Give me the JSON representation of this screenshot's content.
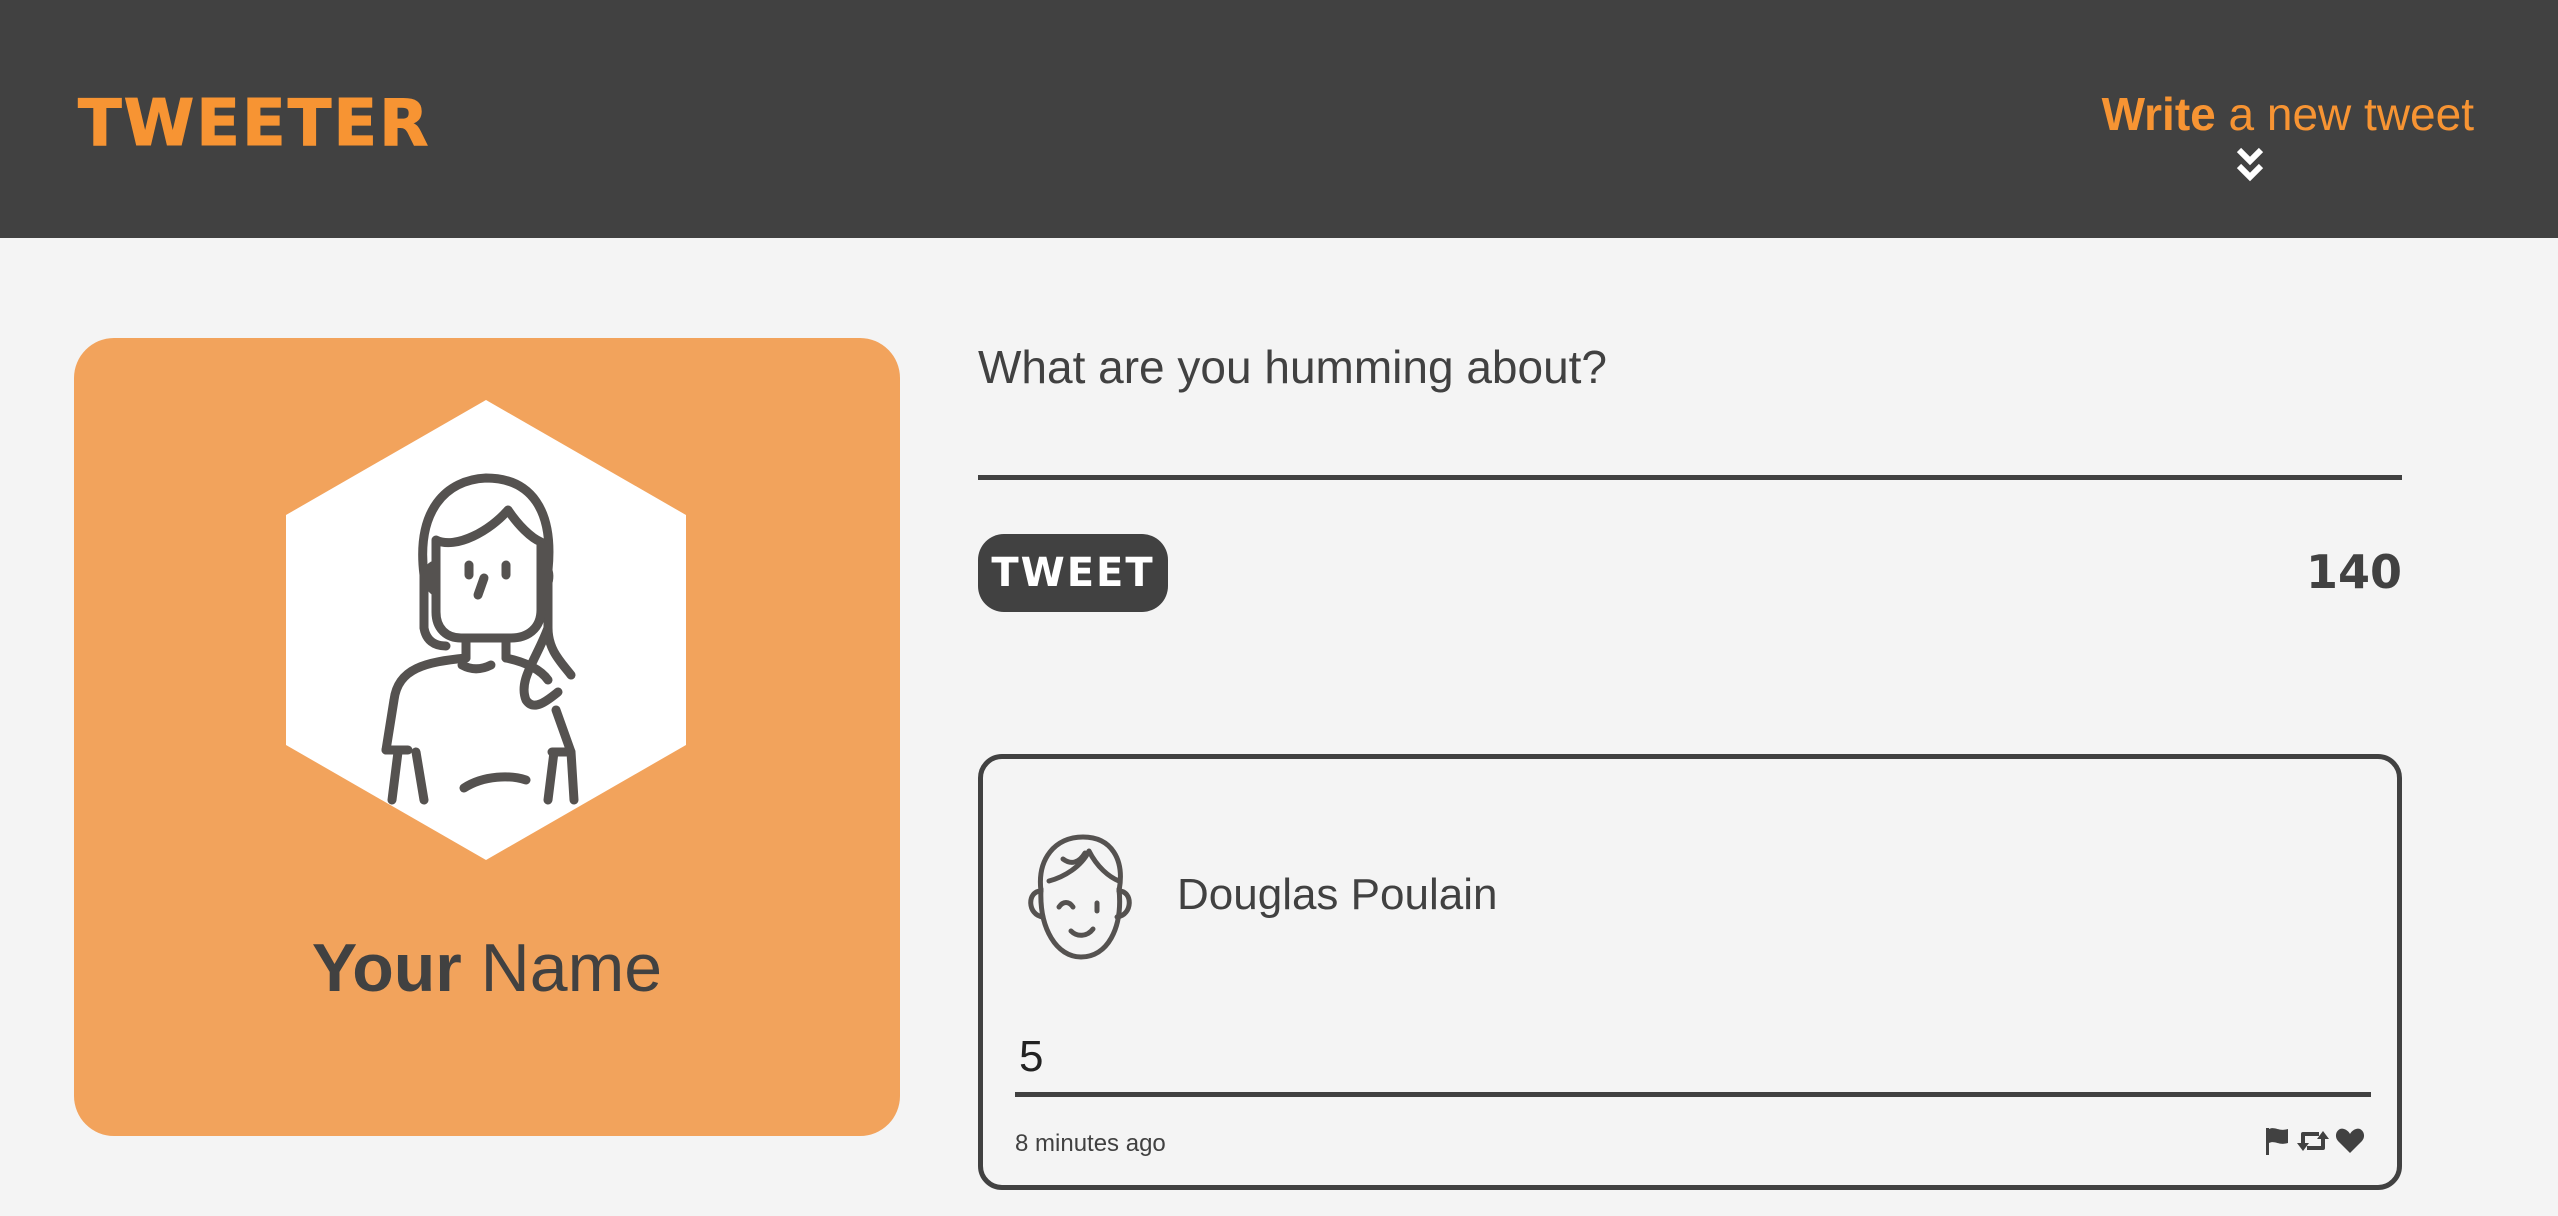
{
  "nav": {
    "brand": "TWEETER",
    "compose_bold": "Write",
    "compose_rest": " a new tweet",
    "compose_icon": "double-chevron-down-icon"
  },
  "profile": {
    "avatar_icon": "female-user-icon",
    "name_bold": "Your",
    "name_rest": " Name"
  },
  "compose": {
    "placeholder": "What are you humming about?",
    "button_label": "TWEET",
    "counter": "140"
  },
  "tweet": {
    "avatar_icon": "winking-face-avatar-icon",
    "author": "Douglas Poulain",
    "content": "5",
    "timestamp": "8 minutes ago",
    "actions": [
      "flag-icon",
      "retweet-icon",
      "heart-icon"
    ]
  },
  "colors": {
    "accent": "#f79433",
    "nav_bg": "#414141",
    "profile_bg": "#f2a35c",
    "page_bg": "#f4f4f4"
  }
}
